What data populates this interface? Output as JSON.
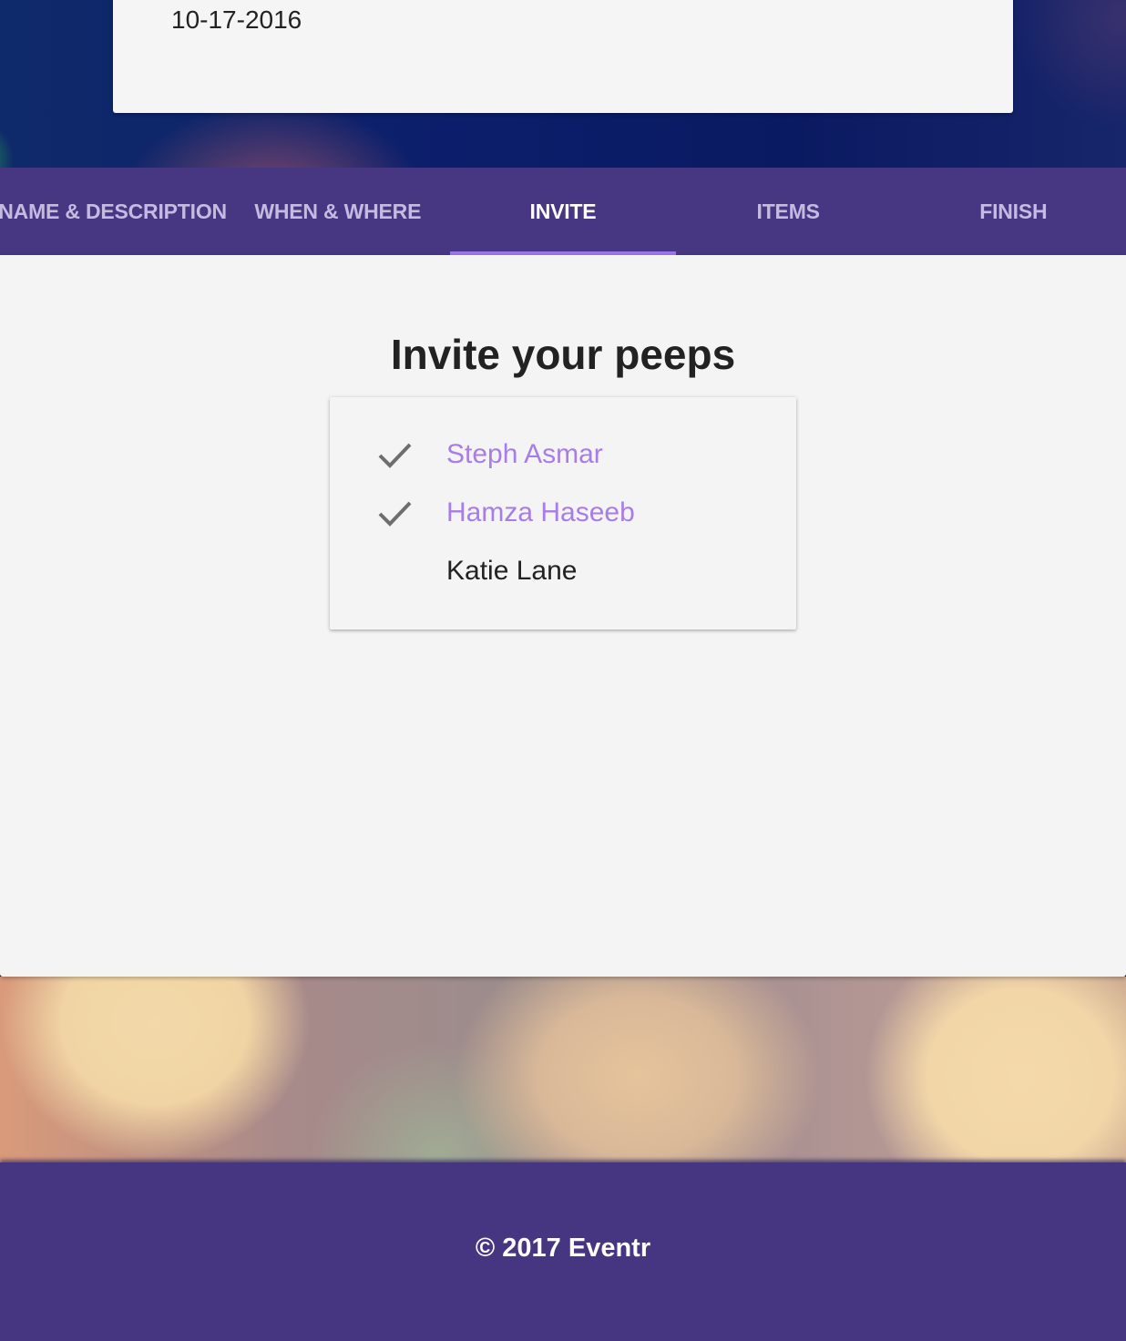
{
  "event_card": {
    "date": "10-17-2016"
  },
  "tabs": [
    {
      "label": "NAME & DESCRIPTION",
      "active": false
    },
    {
      "label": "WHEN & WHERE",
      "active": false
    },
    {
      "label": "INVITE",
      "active": true
    },
    {
      "label": "ITEMS",
      "active": false
    },
    {
      "label": "FINISH",
      "active": false
    }
  ],
  "invite": {
    "title": "Invite your peeps",
    "people": [
      {
        "name": "Steph Asmar",
        "selected": true,
        "icon": "check-icon"
      },
      {
        "name": "Hamza Haseeb",
        "selected": true,
        "icon": "check-icon"
      },
      {
        "name": "Katie Lane",
        "selected": false,
        "icon": ""
      }
    ]
  },
  "footer": {
    "text": "© 2017 Eventr"
  },
  "colors": {
    "tab_bar": "#473782",
    "tab_indicator": "#9d74ea",
    "selected_name": "#a77de8",
    "footer": "#463581"
  }
}
